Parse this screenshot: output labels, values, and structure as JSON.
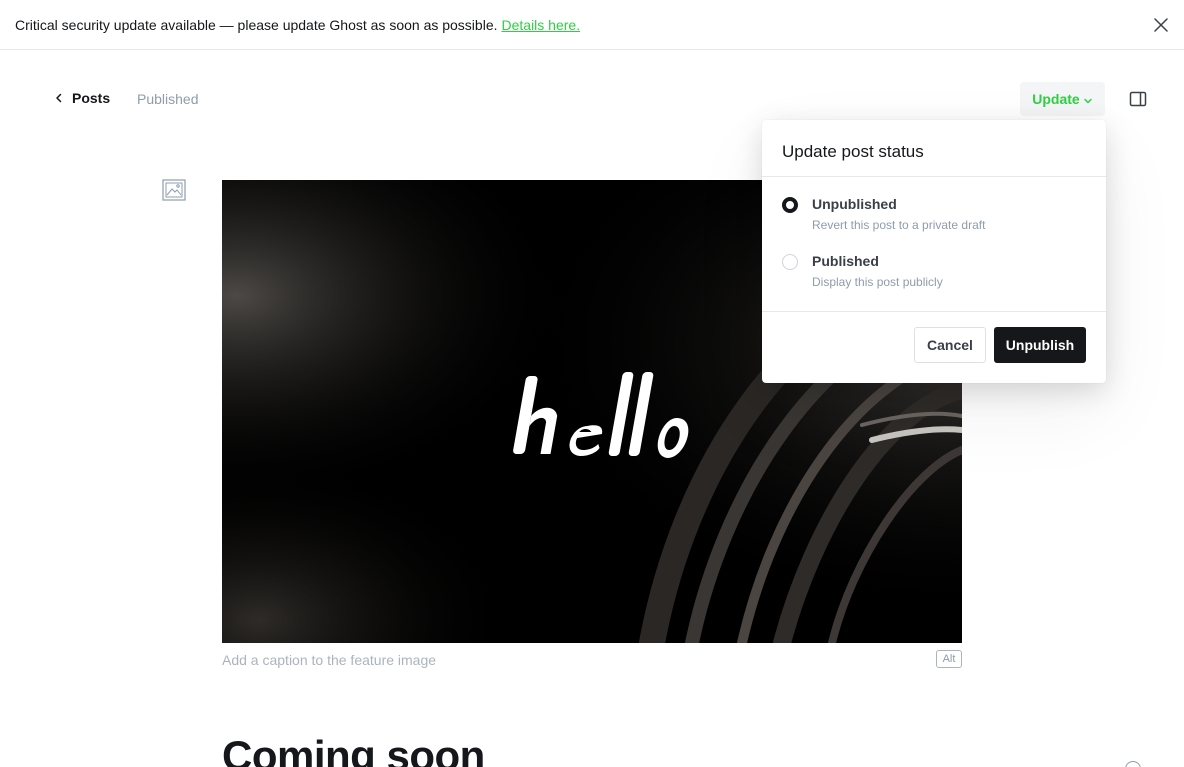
{
  "banner": {
    "message": "Critical security update available — please update Ghost as soon as possible.",
    "link_text": "Details here.",
    "close_icon": "close-icon"
  },
  "header": {
    "back_label": "Posts",
    "status": "Published",
    "update_label": "Update",
    "settings_icon": "sidebar-toggle-icon"
  },
  "feature_image": {
    "text": "hello",
    "caption_placeholder": "Add a caption to the feature image",
    "alt_label": "Alt"
  },
  "post": {
    "title": "Coming soon"
  },
  "popup": {
    "title": "Update post status",
    "options": [
      {
        "label": "Unpublished",
        "description": "Revert this post to a private draft",
        "selected": true
      },
      {
        "label": "Published",
        "description": "Display this post publicly",
        "selected": false
      }
    ],
    "cancel_label": "Cancel",
    "confirm_label": "Unpublish"
  },
  "colors": {
    "accent_green": "#30cf43",
    "dark": "#15171a",
    "muted": "#8e9cac"
  }
}
